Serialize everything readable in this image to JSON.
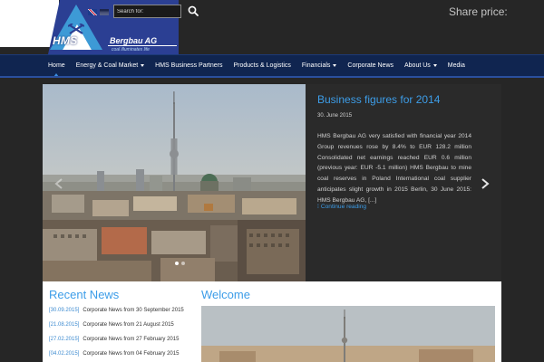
{
  "header": {
    "logo_text": "HMS",
    "company_name": "Bergbau AG",
    "tagline": "coal illuminates life",
    "languages": [
      "English",
      "Deutsch"
    ],
    "search": {
      "placeholder": "Search for:",
      "value": ""
    },
    "share_price_label": "Share price:"
  },
  "nav": {
    "items": [
      {
        "label": "Home",
        "has_dropdown": false,
        "active": true
      },
      {
        "label": "Energy & Coal Market",
        "has_dropdown": true,
        "active": false
      },
      {
        "label": "HMS Business Partners",
        "has_dropdown": false,
        "active": false
      },
      {
        "label": "Products & Logistics",
        "has_dropdown": false,
        "active": false
      },
      {
        "label": "Financials",
        "has_dropdown": true,
        "active": false
      },
      {
        "label": "Corporate News",
        "has_dropdown": false,
        "active": false
      },
      {
        "label": "About Us",
        "has_dropdown": true,
        "active": false
      },
      {
        "label": "Media",
        "has_dropdown": false,
        "active": false
      }
    ]
  },
  "slider": {
    "title": "Business figures for 2014",
    "date": "30. June 2015",
    "body": "HMS Bergbau AG very satisfied with financial year 2014 Group revenues rose by 8.4% to EUR 128.2 million Consolidated net earnings reached EUR 0.6 million (previous year: EUR -5.1 million) HMS Bergbau to mine coal reserves in Poland International coal supplier anticipates slight growth in 2015  Berlin, 30 June 2015: HMS Bergbau AG, [...]",
    "continue_label": "Continue reading",
    "slide_count": 2,
    "active_slide": 1
  },
  "recent_news": {
    "title": "Recent News",
    "items": [
      {
        "date": "[30.09.2015]",
        "text": "Corporate News from 30 September 2015"
      },
      {
        "date": "[21.08.2015]",
        "text": "Corporate News from 21 August 2015"
      },
      {
        "date": "[27.02.2015]",
        "text": "Corporate News from 27 February 2015"
      },
      {
        "date": "[04.02.2015]",
        "text": "Corporate News from 04 February 2015"
      }
    ]
  },
  "welcome": {
    "title": "Welcome"
  },
  "colors": {
    "accent": "#3d9de8",
    "nav_bg": "#102550",
    "logo_blue": "#2b3f93",
    "page_bg": "#262626"
  }
}
